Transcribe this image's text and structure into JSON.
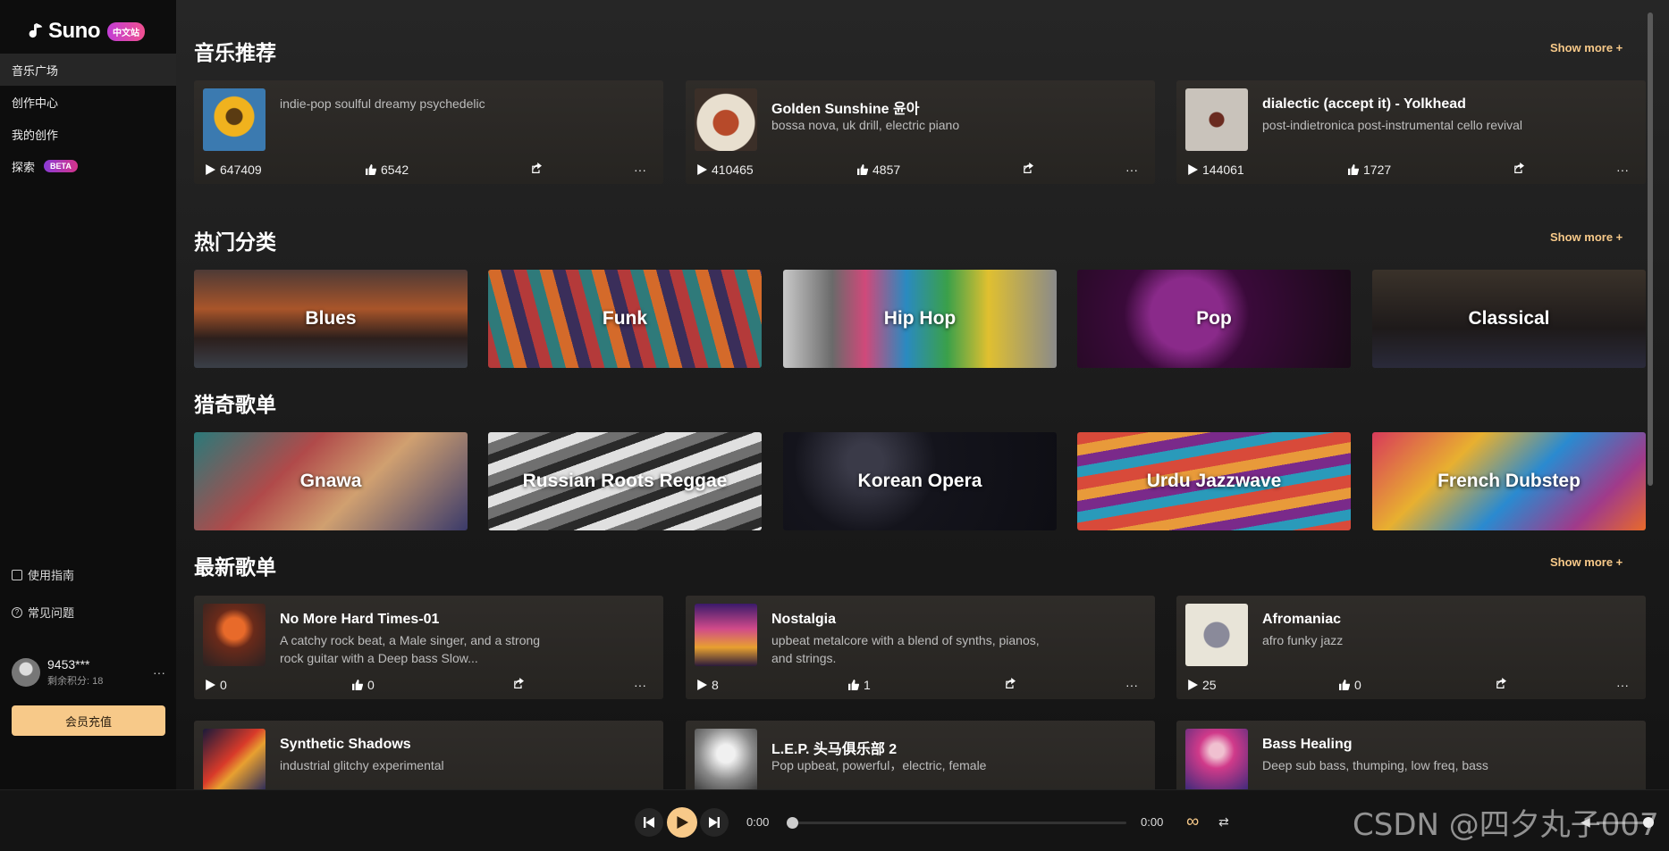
{
  "brand": {
    "name": "Suno",
    "badge": "中文站"
  },
  "nav": [
    {
      "label": "音乐广场",
      "active": true
    },
    {
      "label": "创作中心"
    },
    {
      "label": "我的创作"
    },
    {
      "label": "探索",
      "badge": "BETA"
    }
  ],
  "side_links": {
    "guide": "使用指南",
    "faq": "常见问题"
  },
  "user": {
    "name": "9453***",
    "credits": "剩余积分: 18",
    "more": "···"
  },
  "recharge_label": "会员充值",
  "sections": {
    "recommend": {
      "title": "音乐推荐",
      "show_more": "Show more +"
    },
    "categories": {
      "title": "热门分类",
      "show_more": "Show more +"
    },
    "curious": {
      "title": "猎奇歌单"
    },
    "latest": {
      "title": "最新歌单",
      "show_more": "Show more +"
    }
  },
  "recommend_songs": [
    {
      "title": "",
      "desc": "indie-pop soulful dreamy psychedelic",
      "plays": "647409",
      "likes": "6542"
    },
    {
      "title": "Golden Sunshine 윤아",
      "desc": "bossa nova, uk drill, electric piano",
      "plays": "410465",
      "likes": "4857"
    },
    {
      "title": "dialectic (accept it) - Yolkhead",
      "desc": "post-indietronica post-instrumental cello revival",
      "plays": "144061",
      "likes": "1727"
    }
  ],
  "categories": [
    "Blues",
    "Funk",
    "Hip Hop",
    "Pop",
    "Classical"
  ],
  "curious": [
    "Gnawa",
    "Russian Roots Reggae",
    "Korean Opera",
    "Urdu Jazzwave",
    "French Dubstep"
  ],
  "latest_songs": [
    {
      "title": "No More Hard Times-01",
      "desc": "A catchy rock beat, a Male singer, and a strong rock guitar with a Deep bass Slow...",
      "plays": "0",
      "likes": "0"
    },
    {
      "title": "Nostalgia",
      "desc": "upbeat metalcore with a blend of synths, pianos, and strings.",
      "plays": "8",
      "likes": "1"
    },
    {
      "title": "Afromaniac",
      "desc": "afro funky jazz",
      "plays": "25",
      "likes": "0"
    },
    {
      "title": "Synthetic Shadows",
      "desc": "industrial glitchy experimental"
    },
    {
      "title": "L.E.P. 头马俱乐部 2",
      "desc": "Pop upbeat, powerful，electric, female"
    },
    {
      "title": "Bass Healing",
      "desc": "Deep sub bass, thumping, low freq, bass"
    }
  ],
  "player": {
    "time_current": "0:00",
    "time_total": "0:00",
    "progress": 0
  },
  "watermark": "CSDN @四夕丸子007",
  "colors": {
    "accent": "#f7c989",
    "background": "#131313"
  }
}
